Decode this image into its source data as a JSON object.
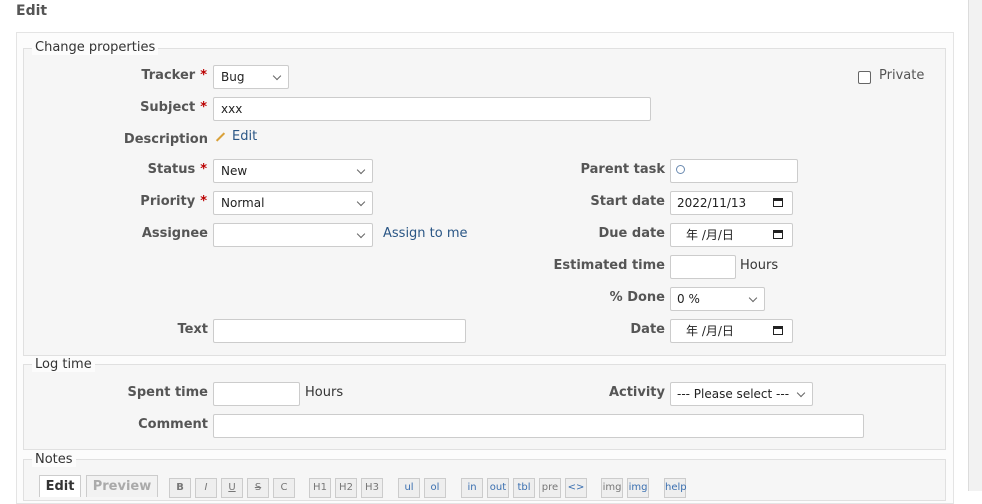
{
  "title": "Edit",
  "properties": {
    "legend": "Change properties",
    "tracker": {
      "label": "Tracker",
      "value": "Bug"
    },
    "private_label": "Private",
    "subject": {
      "label": "Subject",
      "value": "xxx"
    },
    "description": {
      "label": "Description",
      "edit_label": "Edit"
    },
    "status": {
      "label": "Status",
      "value": "New"
    },
    "priority": {
      "label": "Priority",
      "value": "Normal"
    },
    "assignee": {
      "label": "Assignee",
      "value": "",
      "assign_link": "Assign to me"
    },
    "text": {
      "label": "Text",
      "value": ""
    },
    "parent_task": {
      "label": "Parent task"
    },
    "start_date": {
      "label": "Start date",
      "value": "2022/11/13"
    },
    "due_date": {
      "label": "Due date",
      "value": "年 /月/日"
    },
    "estimated_time": {
      "label": "Estimated time",
      "unit": "Hours"
    },
    "done": {
      "label": "% Done",
      "value": "0 %"
    },
    "date": {
      "label": "Date",
      "value": "年 /月/日"
    },
    "required_mark": "*"
  },
  "log_time": {
    "legend": "Log time",
    "spent_time": {
      "label": "Spent time",
      "unit": "Hours"
    },
    "activity": {
      "label": "Activity",
      "value": "--- Please select ---"
    },
    "comment": {
      "label": "Comment"
    }
  },
  "notes": {
    "legend": "Notes",
    "tabs": [
      "Edit",
      "Preview"
    ],
    "toolbar": [
      "B",
      "I",
      "U",
      "S",
      "C",
      "H1",
      "H2",
      "H3",
      "ul",
      "ol",
      "in",
      "out",
      "tbl",
      "pre",
      "<>",
      "img",
      "help"
    ]
  },
  "icons": {
    "pencil": "pencil-icon",
    "search": "magnifier-icon",
    "calendar": "calendar-icon"
  },
  "colors": {
    "required": "#bb0000",
    "link": "#2a5685",
    "fieldset_bg": "#f6f6f6"
  }
}
